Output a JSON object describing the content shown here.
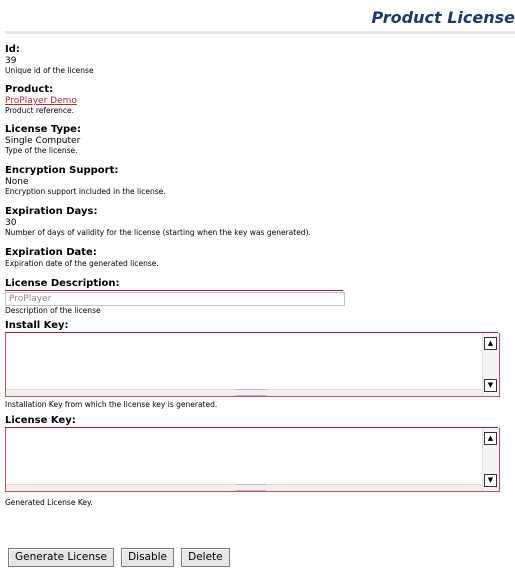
{
  "header": {
    "title": "Product License"
  },
  "fields": {
    "id": {
      "label": "Id:",
      "value": "39",
      "description": "Unique id of the license"
    },
    "product": {
      "label": "Product:",
      "value": "ProPlayer Demo",
      "description": "Product reference."
    },
    "license_type": {
      "label": "License Type:",
      "value": "Single Computer",
      "description": "Type of the license."
    },
    "encryption": {
      "label": "Encryption Support:",
      "value": "None",
      "description": "Encryption support included in the license."
    },
    "expiration_days": {
      "label": "Expiration Days:",
      "value": "30",
      "description": "Number of days of validity for the license (starting when the key was generated)."
    },
    "expiration_date": {
      "label": "Expiration Date:",
      "description": "Expiration date of the generated license."
    },
    "license_description": {
      "label": "License Description:",
      "value": "ProPlayer",
      "description": "Description of the license"
    },
    "install_key": {
      "label": "Install Key:",
      "value": "",
      "description": "Installation Key from which the license key is generated."
    },
    "license_key": {
      "label": "License Key:",
      "value": "",
      "description": "Generated License Key."
    }
  },
  "buttons": {
    "generate": "Generate License",
    "disable": "Disable",
    "delete": "Delete"
  },
  "icons": {
    "scroll_up": "scroll-up-arrow-icon",
    "scroll_down": "scroll-down-arrow-icon"
  },
  "colors": {
    "title": "#1f3a63",
    "link": "#b0312b",
    "field_border": "#b55858"
  }
}
